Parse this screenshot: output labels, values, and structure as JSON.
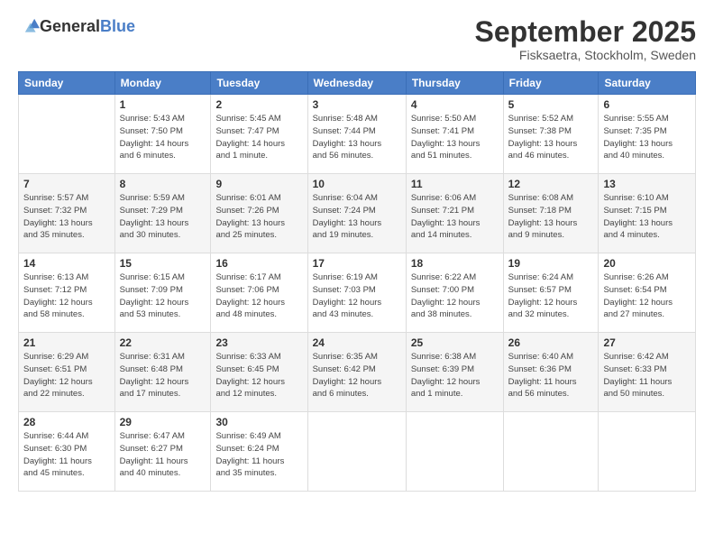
{
  "header": {
    "logo_general": "General",
    "logo_blue": "Blue",
    "month": "September 2025",
    "location": "Fisksaetra, Stockholm, Sweden"
  },
  "weekdays": [
    "Sunday",
    "Monday",
    "Tuesday",
    "Wednesday",
    "Thursday",
    "Friday",
    "Saturday"
  ],
  "weeks": [
    [
      {
        "day": "",
        "info": ""
      },
      {
        "day": "1",
        "info": "Sunrise: 5:43 AM\nSunset: 7:50 PM\nDaylight: 14 hours\nand 6 minutes."
      },
      {
        "day": "2",
        "info": "Sunrise: 5:45 AM\nSunset: 7:47 PM\nDaylight: 14 hours\nand 1 minute."
      },
      {
        "day": "3",
        "info": "Sunrise: 5:48 AM\nSunset: 7:44 PM\nDaylight: 13 hours\nand 56 minutes."
      },
      {
        "day": "4",
        "info": "Sunrise: 5:50 AM\nSunset: 7:41 PM\nDaylight: 13 hours\nand 51 minutes."
      },
      {
        "day": "5",
        "info": "Sunrise: 5:52 AM\nSunset: 7:38 PM\nDaylight: 13 hours\nand 46 minutes."
      },
      {
        "day": "6",
        "info": "Sunrise: 5:55 AM\nSunset: 7:35 PM\nDaylight: 13 hours\nand 40 minutes."
      }
    ],
    [
      {
        "day": "7",
        "info": "Sunrise: 5:57 AM\nSunset: 7:32 PM\nDaylight: 13 hours\nand 35 minutes."
      },
      {
        "day": "8",
        "info": "Sunrise: 5:59 AM\nSunset: 7:29 PM\nDaylight: 13 hours\nand 30 minutes."
      },
      {
        "day": "9",
        "info": "Sunrise: 6:01 AM\nSunset: 7:26 PM\nDaylight: 13 hours\nand 25 minutes."
      },
      {
        "day": "10",
        "info": "Sunrise: 6:04 AM\nSunset: 7:24 PM\nDaylight: 13 hours\nand 19 minutes."
      },
      {
        "day": "11",
        "info": "Sunrise: 6:06 AM\nSunset: 7:21 PM\nDaylight: 13 hours\nand 14 minutes."
      },
      {
        "day": "12",
        "info": "Sunrise: 6:08 AM\nSunset: 7:18 PM\nDaylight: 13 hours\nand 9 minutes."
      },
      {
        "day": "13",
        "info": "Sunrise: 6:10 AM\nSunset: 7:15 PM\nDaylight: 13 hours\nand 4 minutes."
      }
    ],
    [
      {
        "day": "14",
        "info": "Sunrise: 6:13 AM\nSunset: 7:12 PM\nDaylight: 12 hours\nand 58 minutes."
      },
      {
        "day": "15",
        "info": "Sunrise: 6:15 AM\nSunset: 7:09 PM\nDaylight: 12 hours\nand 53 minutes."
      },
      {
        "day": "16",
        "info": "Sunrise: 6:17 AM\nSunset: 7:06 PM\nDaylight: 12 hours\nand 48 minutes."
      },
      {
        "day": "17",
        "info": "Sunrise: 6:19 AM\nSunset: 7:03 PM\nDaylight: 12 hours\nand 43 minutes."
      },
      {
        "day": "18",
        "info": "Sunrise: 6:22 AM\nSunset: 7:00 PM\nDaylight: 12 hours\nand 38 minutes."
      },
      {
        "day": "19",
        "info": "Sunrise: 6:24 AM\nSunset: 6:57 PM\nDaylight: 12 hours\nand 32 minutes."
      },
      {
        "day": "20",
        "info": "Sunrise: 6:26 AM\nSunset: 6:54 PM\nDaylight: 12 hours\nand 27 minutes."
      }
    ],
    [
      {
        "day": "21",
        "info": "Sunrise: 6:29 AM\nSunset: 6:51 PM\nDaylight: 12 hours\nand 22 minutes."
      },
      {
        "day": "22",
        "info": "Sunrise: 6:31 AM\nSunset: 6:48 PM\nDaylight: 12 hours\nand 17 minutes."
      },
      {
        "day": "23",
        "info": "Sunrise: 6:33 AM\nSunset: 6:45 PM\nDaylight: 12 hours\nand 12 minutes."
      },
      {
        "day": "24",
        "info": "Sunrise: 6:35 AM\nSunset: 6:42 PM\nDaylight: 12 hours\nand 6 minutes."
      },
      {
        "day": "25",
        "info": "Sunrise: 6:38 AM\nSunset: 6:39 PM\nDaylight: 12 hours\nand 1 minute."
      },
      {
        "day": "26",
        "info": "Sunrise: 6:40 AM\nSunset: 6:36 PM\nDaylight: 11 hours\nand 56 minutes."
      },
      {
        "day": "27",
        "info": "Sunrise: 6:42 AM\nSunset: 6:33 PM\nDaylight: 11 hours\nand 50 minutes."
      }
    ],
    [
      {
        "day": "28",
        "info": "Sunrise: 6:44 AM\nSunset: 6:30 PM\nDaylight: 11 hours\nand 45 minutes."
      },
      {
        "day": "29",
        "info": "Sunrise: 6:47 AM\nSunset: 6:27 PM\nDaylight: 11 hours\nand 40 minutes."
      },
      {
        "day": "30",
        "info": "Sunrise: 6:49 AM\nSunset: 6:24 PM\nDaylight: 11 hours\nand 35 minutes."
      },
      {
        "day": "",
        "info": ""
      },
      {
        "day": "",
        "info": ""
      },
      {
        "day": "",
        "info": ""
      },
      {
        "day": "",
        "info": ""
      }
    ]
  ]
}
